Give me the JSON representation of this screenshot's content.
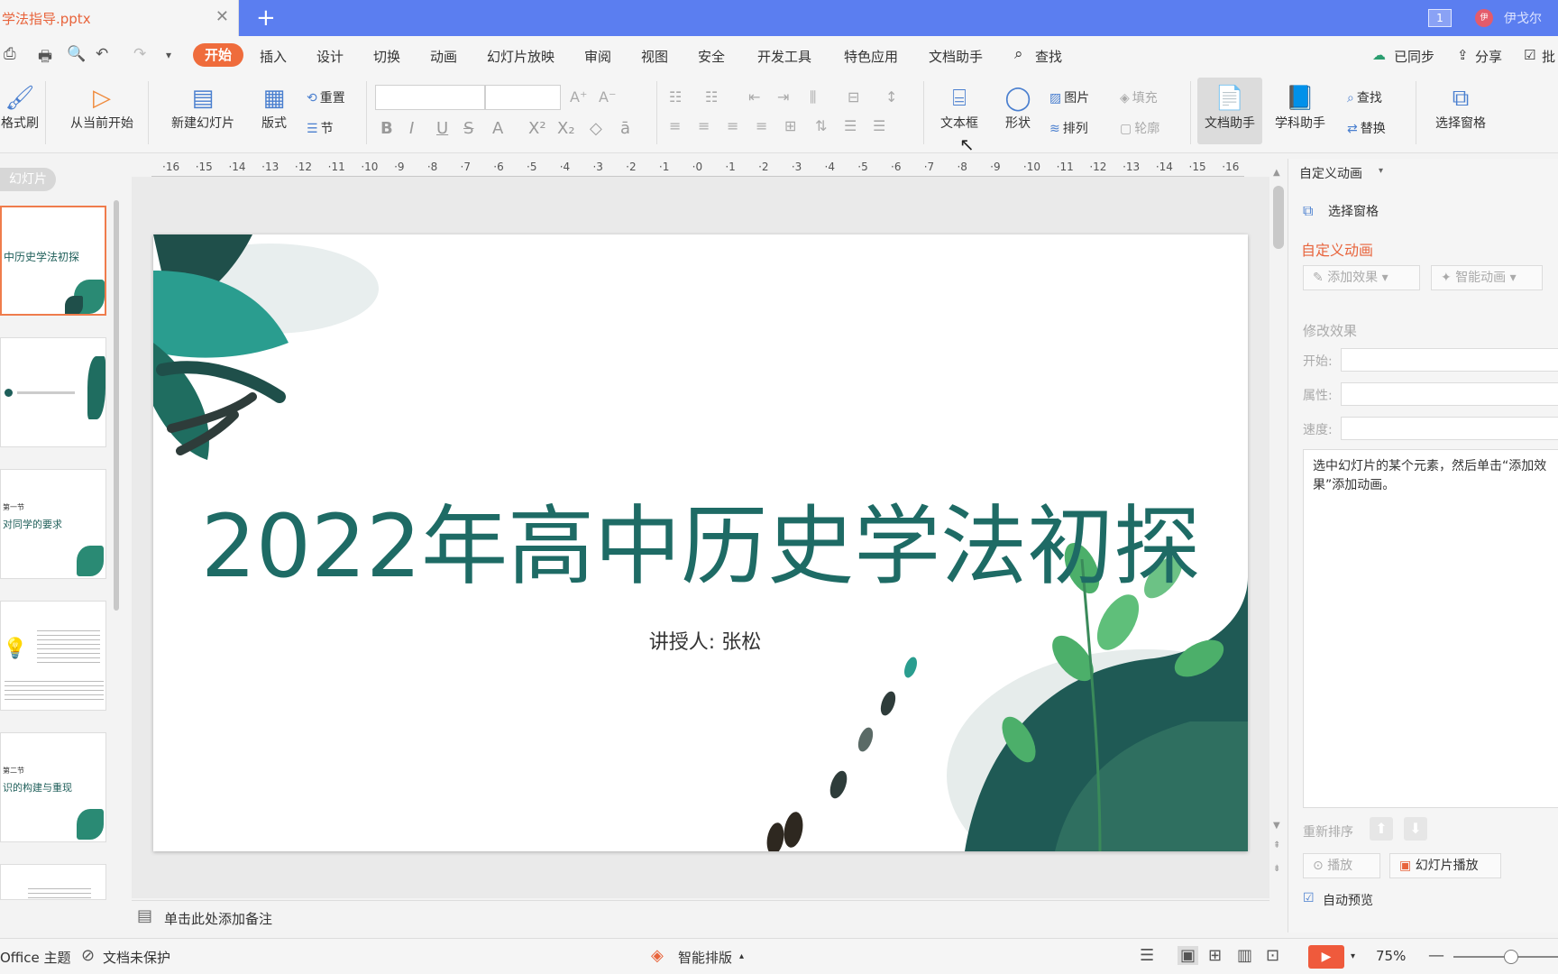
{
  "titlebar": {
    "doc_name": "学法指导.pptx",
    "close": "✕",
    "new_tab": "+",
    "badge": "1",
    "avatar": "伊",
    "user": "伊戈尔"
  },
  "menu": {
    "items": [
      "开始",
      "插入",
      "设计",
      "切换",
      "动画",
      "幻灯片放映",
      "审阅",
      "视图",
      "安全",
      "开发工具",
      "特色应用",
      "文档助手"
    ],
    "find": "查找",
    "sync": "已同步",
    "share": "分享",
    "batch": "批"
  },
  "ribbon": {
    "format_painter": "格式刷",
    "from_current": "从当前开始",
    "new_slide": "新建幻灯片",
    "layout": "版式",
    "reset": "重置",
    "section": "节",
    "textbox": "文本框",
    "shape": "形状",
    "picture": "图片",
    "arrange": "排列",
    "fill": "填充",
    "outline": "轮廓",
    "doc_assistant": "文档助手",
    "subject_assistant": "学科助手",
    "find": "查找",
    "replace": "替换",
    "selection_pane": "选择窗格"
  },
  "ruler": {
    "ticks": [
      "16",
      "15",
      "14",
      "13",
      "12",
      "11",
      "10",
      "9",
      "8",
      "7",
      "6",
      "5",
      "4",
      "3",
      "2",
      "1",
      "0",
      "1",
      "2",
      "3",
      "4",
      "5",
      "6",
      "7",
      "8",
      "9",
      "10",
      "11",
      "12",
      "13",
      "14",
      "15",
      "16"
    ]
  },
  "thumbs": {
    "label": "幻灯片",
    "t1": "中历史学法初探",
    "t3_small": "第一节",
    "t3": "对同学的要求",
    "t5_small": "第二节",
    "t5": "识的构建与重现"
  },
  "slide": {
    "title": "2022年高中历史学法初探",
    "subtitle": "讲授人:  张松",
    "colors": {
      "title": "#1e6b65",
      "leaf_dark": "#1f4f4a",
      "leaf_teal": "#2a9d8f",
      "leaf_green": "#4caf6a"
    }
  },
  "notes": {
    "placeholder": "单击此处添加备注"
  },
  "pane": {
    "header": "自定义动画",
    "selection_pane": "选择窗格",
    "title": "自定义动画",
    "add_effect": "添加效果",
    "smart_anim": "智能动画",
    "modify": "修改效果",
    "start": "开始:",
    "property": "属性:",
    "speed": "速度:",
    "hint": "选中幻灯片的某个元素，然后单击“添加效果”添加动画。",
    "reorder": "重新排序",
    "play": "播放",
    "slideshow": "幻灯片播放",
    "autopreview": "自动预览"
  },
  "status": {
    "theme": "Office 主题",
    "unprotected": "文档未保护",
    "smart_layout": "智能排版",
    "zoom": "75%"
  }
}
